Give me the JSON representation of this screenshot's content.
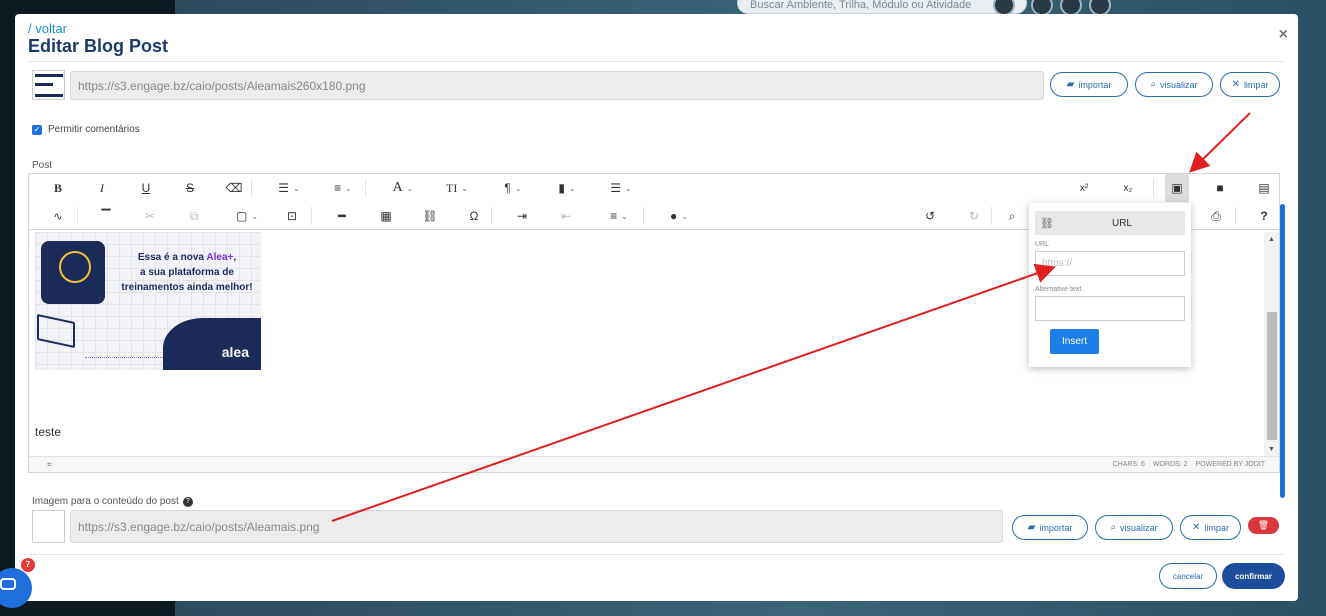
{
  "background": {
    "search_placeholder": "Buscar Ambiente, Trilha, Módulo ou Atividade"
  },
  "modal": {
    "back_link": "/ voltar",
    "title": "Editar Blog Post",
    "close": "×"
  },
  "thumbnail_section": {
    "url": "https://s3.engage.bz/caio/posts/Aleamais260x180.png",
    "buttons": {
      "import": "importar",
      "view": "visualizar",
      "clear": "limpar"
    }
  },
  "comments_checkbox": {
    "label": "Permitir comentários",
    "checked": true
  },
  "post_label": "Post",
  "editor": {
    "toolbar_row1": [
      "bold",
      "italic",
      "underline",
      "strikethrough",
      "eraser",
      "ul",
      "ol",
      "font",
      "fontsize",
      "paragraph",
      "classSpan",
      "lineHeight",
      "superscript",
      "subscript",
      "image",
      "video",
      "file"
    ],
    "toolbar_row2": [
      "brush",
      "copyformat",
      "cut",
      "copy",
      "paste",
      "selectall",
      "hr",
      "table",
      "link",
      "symbols",
      "indent",
      "outdent",
      "align",
      "brushcolor",
      "undo",
      "redo",
      "find",
      "source",
      "fullsize",
      "print",
      "help"
    ],
    "glyphs": {
      "bold": "B",
      "italic": "I",
      "underline": "U",
      "strike": "S",
      "superscript": "x²",
      "subscript": "x₂",
      "help": "?",
      "omega": "Ω",
      "font": "A",
      "fontsize": "TI",
      "para": "¶"
    },
    "banner": {
      "line1_prefix": "Essa é a nova ",
      "line1_highlight": "Alea+",
      "line1_suffix": ",",
      "line2": "a sua plataforma de",
      "line3": "treinamentos ainda melhor!",
      "logo": "alea"
    },
    "body_text": "teste",
    "status": {
      "chars": "CHARS: 6",
      "words": "WORDS: 2",
      "powered": "POWERED BY JODIT"
    }
  },
  "image_popup": {
    "tab_label": "URL",
    "url_label": "URL",
    "url_placeholder": "https://",
    "alt_label": "Alternative text",
    "alt_value": "",
    "insert_button": "Insert"
  },
  "content_image": {
    "label": "Imagem para o conteúdo do post",
    "url": "https://s3.engage.bz/caio/posts/Aleamais.png",
    "buttons": {
      "import": "importar",
      "view": "visualizar",
      "clear": "limpar"
    }
  },
  "footer": {
    "cancel": "cancelar",
    "confirm": "confirmar"
  },
  "chat": {
    "badge_count": "7"
  },
  "colors": {
    "primary": "#2b6cb0",
    "title": "#1d3a6a",
    "danger": "#d9363e",
    "annotation_arrow": "#e02020"
  }
}
